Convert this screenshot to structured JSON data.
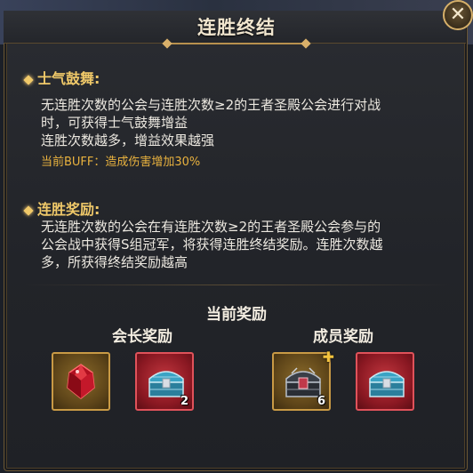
{
  "dialog": {
    "title": "连胜终结",
    "close_label": "✕"
  },
  "morale": {
    "heading": "士气鼓舞:",
    "line1": "无连胜次数的公会与连胜次数≥2的王者圣殿公会进行对战",
    "line2": "时，可获得士气鼓舞增益",
    "line3": "连胜次数越多，增益效果越强",
    "buff": "当前BUFF：造成伤害增加30%"
  },
  "streak_reward": {
    "heading": "连胜奖励:",
    "line1": "无连胜次数的公会在有连胜次数≥2的王者圣殿公会参与的",
    "line2": "公会战中获得S组冠军，将获得连胜终结奖励。连胜次数越",
    "line3": "多，所获得终结奖励越高"
  },
  "current_rewards": {
    "title": "当前奖励",
    "leader": {
      "title": "会长奖励",
      "items": [
        {
          "icon": "red-gem-icon",
          "frame": "gold",
          "count": ""
        },
        {
          "icon": "blue-chest-icon",
          "frame": "red",
          "count": "2"
        }
      ]
    },
    "member": {
      "title": "成员奖励",
      "items": [
        {
          "icon": "dark-chest-icon",
          "frame": "gold",
          "count": "6"
        },
        {
          "icon": "blue-chest-icon",
          "frame": "red",
          "count": ""
        }
      ]
    }
  },
  "colors": {
    "accent_gold": "#f0c969",
    "buff_text": "#e9b23e",
    "panel_bg": "#222429"
  }
}
